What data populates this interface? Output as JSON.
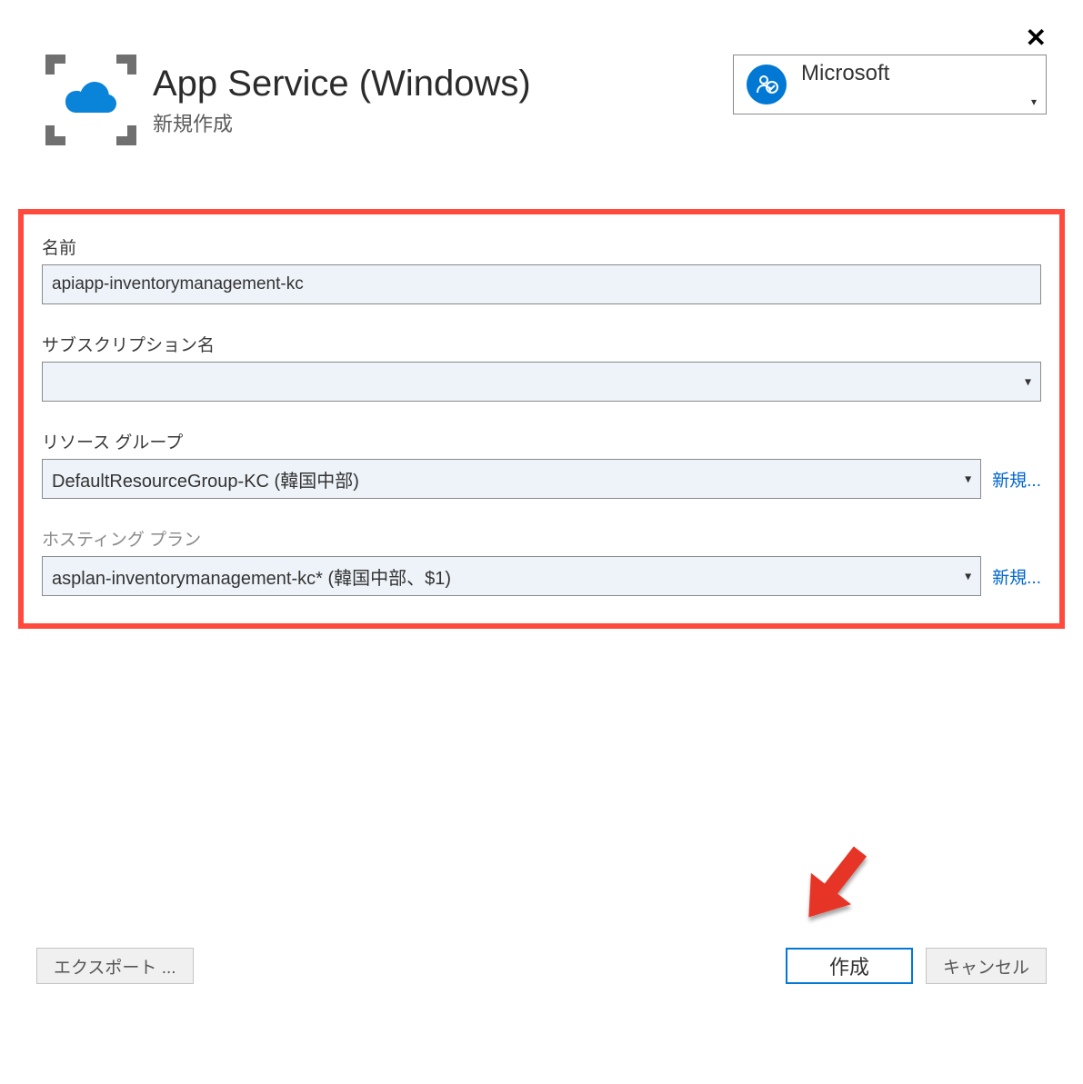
{
  "header": {
    "title": "App Service (Windows)",
    "subtitle": "新規作成",
    "account": "Microsoft"
  },
  "form": {
    "name_label": "名前",
    "name_value": "apiapp-inventorymanagement-kc",
    "subscription_label": "サブスクリプション名",
    "subscription_value": "",
    "resource_group_label": "リソース グループ",
    "resource_group_value": "DefaultResourceGroup-KC  (韓国中部)",
    "hosting_plan_label": "ホスティング プラン",
    "hosting_plan_value": "asplan-inventorymanagement-kc*  (韓国中部、$1)",
    "new_link": "新規..."
  },
  "buttons": {
    "export": "エクスポート ...",
    "create": "作成",
    "cancel": "キャンセル"
  }
}
